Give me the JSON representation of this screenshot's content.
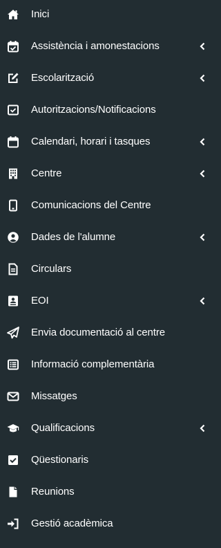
{
  "colors": {
    "sidebar_bg": "#222d32",
    "text": "#ffffff",
    "icon": "#ffffff"
  },
  "menu": {
    "items": [
      {
        "label": "Inici",
        "icon": "home-icon",
        "submenu": false
      },
      {
        "label": "Assistència i amonestacions",
        "icon": "calendar-check-icon",
        "submenu": true
      },
      {
        "label": "Escolarització",
        "icon": "edit-icon",
        "submenu": true
      },
      {
        "label": "Autoritzacions/Notificacions",
        "icon": "checkbox-icon",
        "submenu": false
      },
      {
        "label": "Calendari, horari i tasques",
        "icon": "calendar-icon",
        "submenu": true
      },
      {
        "label": "Centre",
        "icon": "building-icon",
        "submenu": true
      },
      {
        "label": "Comunicacions del Centre",
        "icon": "tablet-icon",
        "submenu": false
      },
      {
        "label": "Dades de l'alumne",
        "icon": "user-circle-icon",
        "submenu": true
      },
      {
        "label": "Circulars",
        "icon": "file-text-icon",
        "submenu": false
      },
      {
        "label": "EOI",
        "icon": "id-badge-icon",
        "submenu": true
      },
      {
        "label": "Envia documentació al centre",
        "icon": "paper-plane-icon",
        "submenu": false
      },
      {
        "label": "Informació complementària",
        "icon": "list-alt-icon",
        "submenu": false
      },
      {
        "label": "Missatges",
        "icon": "envelope-icon",
        "submenu": false
      },
      {
        "label": "Qualificacions",
        "icon": "graduation-cap-icon",
        "submenu": true
      },
      {
        "label": "Qüestionaris",
        "icon": "check-square-icon",
        "submenu": false
      },
      {
        "label": "Reunions",
        "icon": "file-icon",
        "submenu": false
      },
      {
        "label": "Gestió acadèmica",
        "icon": "sign-in-icon",
        "submenu": false
      }
    ]
  }
}
